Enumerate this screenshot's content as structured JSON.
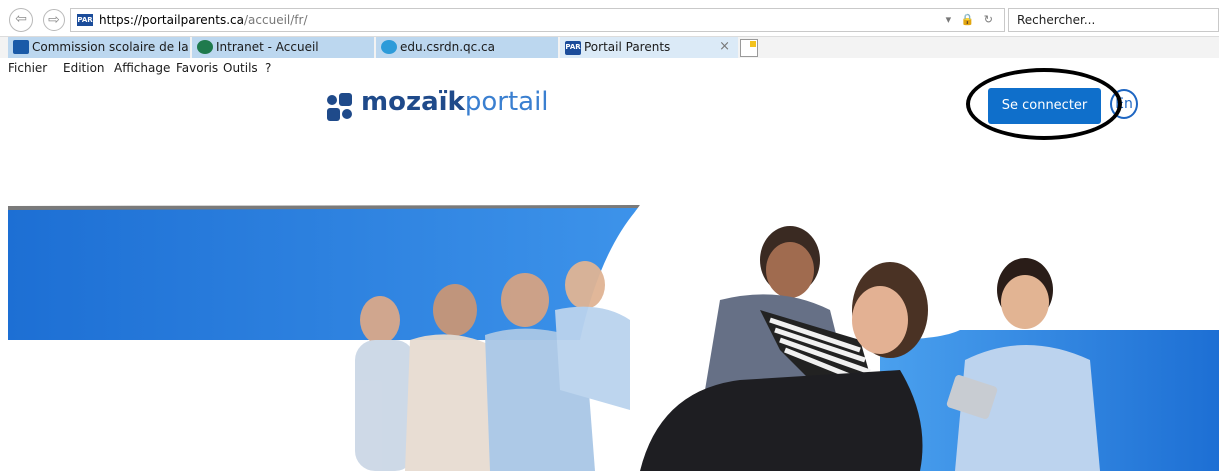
{
  "browser": {
    "url_scheme": "https://",
    "url_domain": "portailparents.ca",
    "url_path": "/accueil/fr/",
    "favicon_text": "PAR",
    "url_tools": "▾ 🔒 ↻",
    "search_placeholder": "Rechercher...",
    "nav_back_icon": "⇦",
    "nav_forward_icon": "⇨"
  },
  "tabs": [
    {
      "label": "Commission scolaire de la Rivi...",
      "icon": "fleur-de-lis-icon",
      "color": "#1a5aa8"
    },
    {
      "label": "Intranet - Accueil",
      "icon": "sharepoint-icon",
      "color": "#1f7a4d"
    },
    {
      "label": "edu.csrdn.qc.ca",
      "icon": "ie-icon",
      "color": "#2d9bd9"
    },
    {
      "label": "Portail Parents",
      "icon": "par-icon",
      "color": "#1b4c9a"
    }
  ],
  "tab_close": "×",
  "menu": [
    "Fichier",
    "Edition",
    "Affichage",
    "Favoris",
    "Outils",
    "?"
  ],
  "page": {
    "logo_bold": "mozaïk",
    "logo_light": "portail",
    "connect_label": "Se connecter",
    "lang_label": "En",
    "brand_color": "#0f6fcb"
  }
}
